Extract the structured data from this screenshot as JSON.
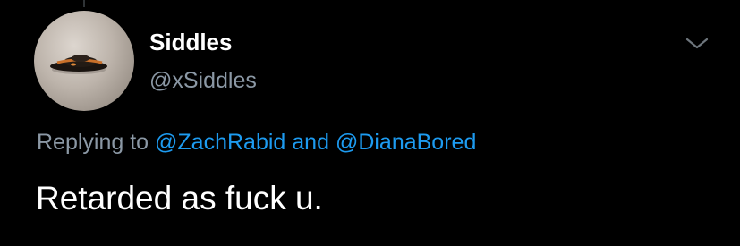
{
  "colors": {
    "background": "#000000",
    "name_text": "#ffffff",
    "secondary_text": "#8b98a5",
    "mention_link": "#1d9bf0"
  },
  "author": {
    "display_name": "Siddles",
    "handle": "@xSiddles",
    "avatar_icon": "ufo-photo-avatar"
  },
  "menu": {
    "icon": "chevron-down-icon"
  },
  "reply": {
    "prefix": "Replying to",
    "mention_1": "@ZachRabid",
    "conjunction": "and",
    "mention_2": "@DianaBored"
  },
  "tweet": {
    "text": "Retarded as fuck u."
  }
}
